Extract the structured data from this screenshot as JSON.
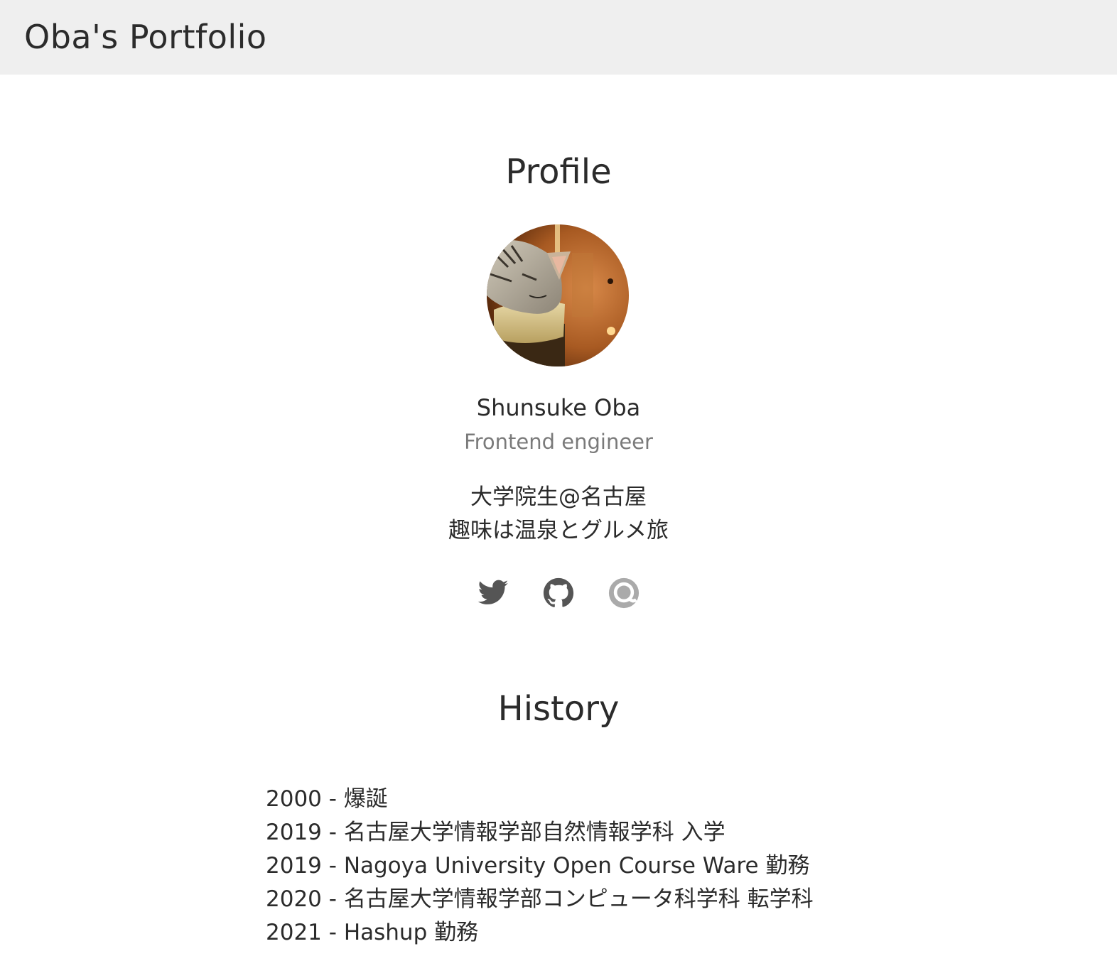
{
  "header": {
    "title": "Oba's Portfolio"
  },
  "profile": {
    "section_title": "Profile",
    "avatar_icon": "cat-photo-avatar",
    "name": "Shunsuke Oba",
    "role": "Frontend engineer",
    "bio": [
      "大学院生@名古屋",
      "趣味は温泉とグルメ旅"
    ],
    "social_links": [
      {
        "icon": "twitter-icon",
        "color": "#555555"
      },
      {
        "icon": "github-icon",
        "color": "#555555"
      },
      {
        "icon": "qiita-icon",
        "color": "#aaaaaa"
      }
    ]
  },
  "history": {
    "section_title": "History",
    "items": [
      {
        "year": "2000",
        "text": "爆誕"
      },
      {
        "year": "2019",
        "text": "名古屋大学情報学部自然情報学科 入学"
      },
      {
        "year": "2019",
        "text": "Nagoya University Open Course Ware 勤務"
      },
      {
        "year": "2020",
        "text": "名古屋大学情報学部コンピュータ科学科 転学科"
      },
      {
        "year": "2021",
        "text": "Hashup 勤務"
      }
    ]
  },
  "colors": {
    "header_bg": "#efefef",
    "text": "#2b2b2b",
    "muted": "#7a7a7a"
  }
}
